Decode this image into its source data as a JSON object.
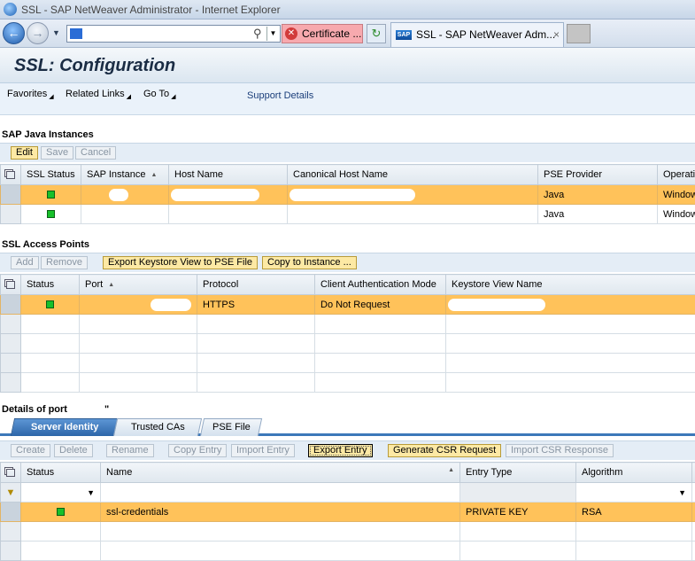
{
  "window": {
    "title": "SSL - SAP NetWeaver Administrator - Internet Explorer"
  },
  "browser": {
    "certificate_label": "Certificate ...",
    "tab_title": "SSL - SAP NetWeaver Adm...",
    "tab_close": "×",
    "sap_logo": "SAP"
  },
  "page": {
    "title": "SSL: Configuration",
    "menu": {
      "favorites": "Favorites",
      "related_links": "Related Links",
      "go_to": "Go To",
      "support_details": "Support Details"
    }
  },
  "java_instances": {
    "title": "SAP Java Instances",
    "buttons": {
      "edit": "Edit",
      "save": "Save",
      "cancel": "Cancel"
    },
    "columns": [
      "SSL Status",
      "SAP Instance",
      "Host Name",
      "Canonical Host Name",
      "PSE Provider",
      "Operati"
    ],
    "rows": [
      {
        "pse_provider": "Java",
        "os": "Window"
      },
      {
        "pse_provider": "Java",
        "os": "Window"
      }
    ]
  },
  "access_points": {
    "title": "SSL Access Points",
    "buttons": {
      "add": "Add",
      "remove": "Remove",
      "export_pse": "Export Keystore View to PSE File",
      "copy_instance": "Copy to Instance ..."
    },
    "columns": [
      "Status",
      "Port",
      "Protocol",
      "Client Authentication Mode",
      "Keystore View Name"
    ],
    "rows": [
      {
        "protocol": "HTTPS",
        "client_auth": "Do Not Request"
      }
    ]
  },
  "details": {
    "title": "Details of port",
    "title_suffix": "\"",
    "tabs": [
      "Server Identity",
      "Trusted CAs",
      "PSE File"
    ],
    "buttons": {
      "create": "Create",
      "delete": "Delete",
      "rename": "Rename",
      "copy_entry": "Copy Entry",
      "import_entry": "Import Entry",
      "export_entry": "Export Entry",
      "generate_csr": "Generate CSR Request",
      "import_csr": "Import CSR Response"
    },
    "columns": [
      "Status",
      "Name",
      "Entry Type",
      "Algorithm"
    ],
    "rows": [
      {
        "name": "ssl-credentials",
        "entry_type": "PRIVATE KEY",
        "algorithm": "RSA"
      }
    ]
  }
}
